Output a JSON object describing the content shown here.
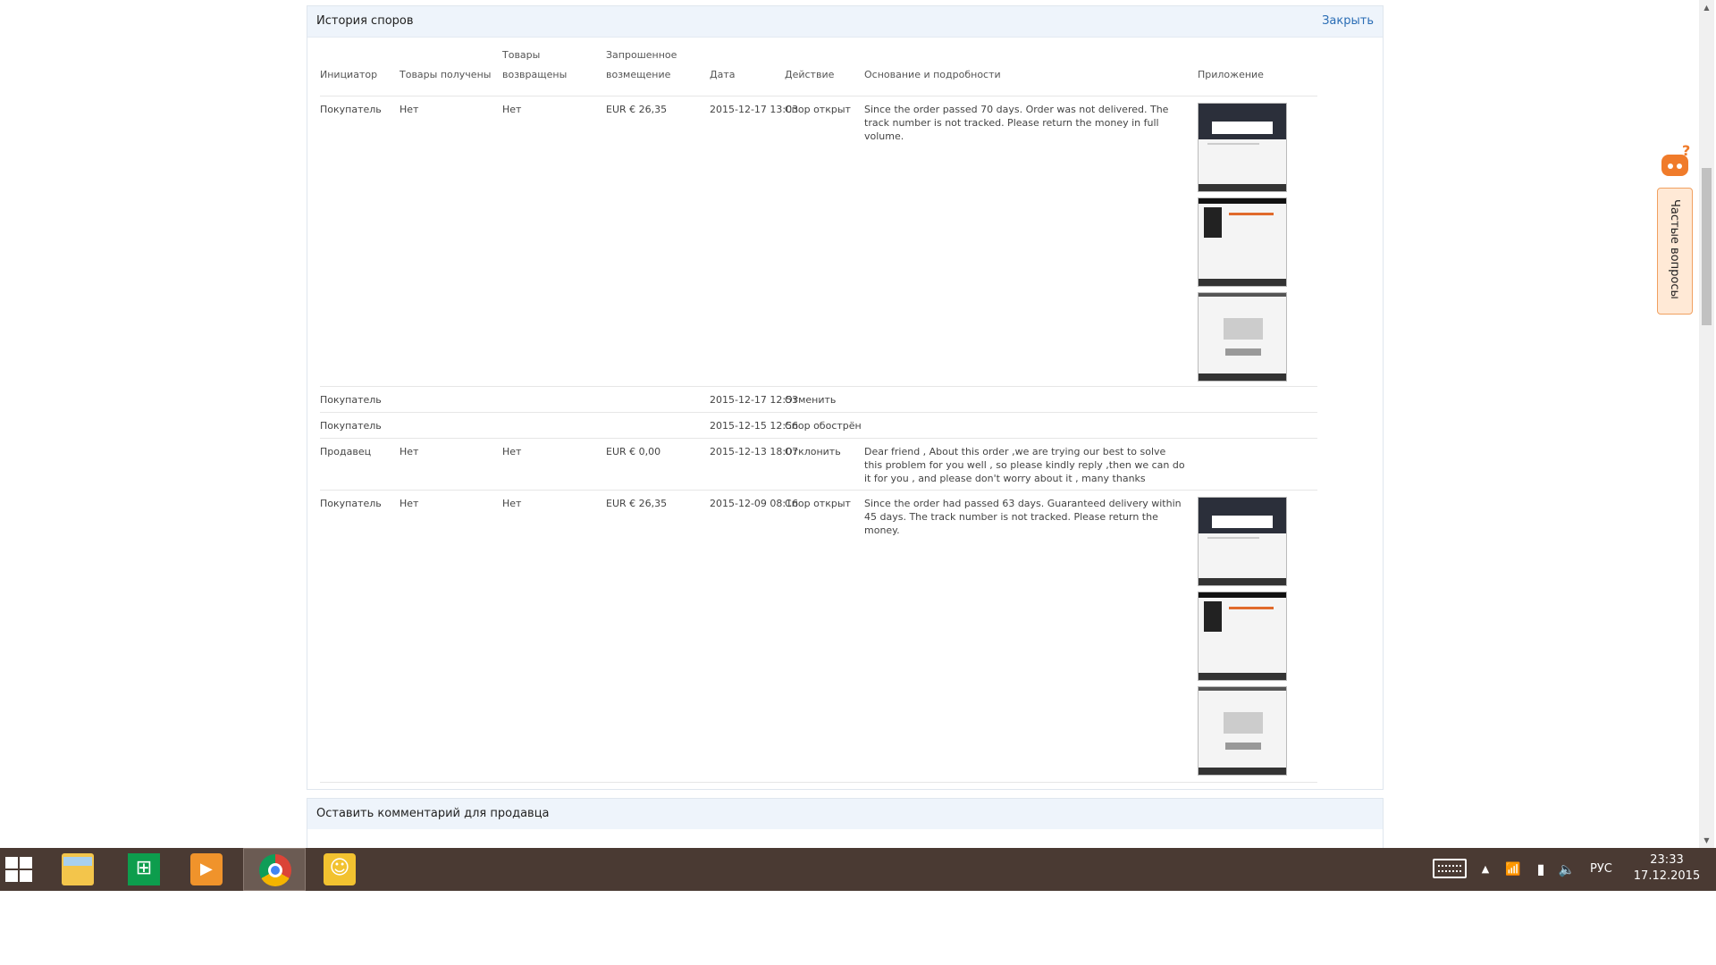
{
  "dispute_history": {
    "title": "История споров",
    "close_label": "Закрыть",
    "columns": {
      "initiator": "Инициатор",
      "received": "Товары получены",
      "returned_line1": "Товары",
      "returned_line2": "возвращены",
      "amount_line1": "Запрошенное",
      "amount_line2": "возмещение",
      "date": "Дата",
      "action": "Действие",
      "details": "Основание и подробности",
      "attachment": "Приложение"
    },
    "rows": [
      {
        "initiator": "Покупатель",
        "received": "Нет",
        "returned": "Нет",
        "amount": "EUR € 26,35",
        "date": "2015-12-17 13:03",
        "action": "Спор открыт",
        "details": "Since the order passed 70 days. Order was not delivered. The track number is not tracked. Please return the money in full volume."
      },
      {
        "initiator": "Покупатель",
        "received": "",
        "returned": "",
        "amount": "",
        "date": "2015-12-17 12:53",
        "action": "Отменить",
        "details": ""
      },
      {
        "initiator": "Покупатель",
        "received": "",
        "returned": "",
        "amount": "",
        "date": "2015-12-15 12:56",
        "action": "Спор обострён",
        "details": ""
      },
      {
        "initiator": "Продавец",
        "received": "Нет",
        "returned": "Нет",
        "amount": "EUR € 0,00",
        "date": "2015-12-13 18:07",
        "action": "Отклонить",
        "details": "Dear friend , About this order ,we are trying our best to solve this problem for you well , so please kindly reply ,then we can do it for you , and please don't worry about it , many thanks"
      },
      {
        "initiator": "Покупатель",
        "received": "Нет",
        "returned": "Нет",
        "amount": "EUR € 26,35",
        "date": "2015-12-09 08:16",
        "action": "Спор открыт",
        "details": "Since the order had passed 63 days. Guaranteed delivery within 45 days. The track number is not tracked. Please return the money."
      }
    ]
  },
  "comment_panel": {
    "title": "Оставить комментарий для продавца"
  },
  "faq": {
    "label": "Частые вопросы",
    "question_mark": "?"
  },
  "taskbar": {
    "apps": [
      "file-explorer",
      "store",
      "video",
      "chrome",
      "messenger"
    ],
    "tray": {
      "arrow": "▲",
      "signal": "📶",
      "battery": "▮",
      "volume": "🔈",
      "language": "РУС",
      "time": "23:33",
      "date": "17.12.2015"
    }
  },
  "colors": {
    "accent_link": "#2a6db5",
    "panel_header": "#eef4fb",
    "taskbar": "#4a3a33",
    "faq_orange": "#f07b2a"
  }
}
